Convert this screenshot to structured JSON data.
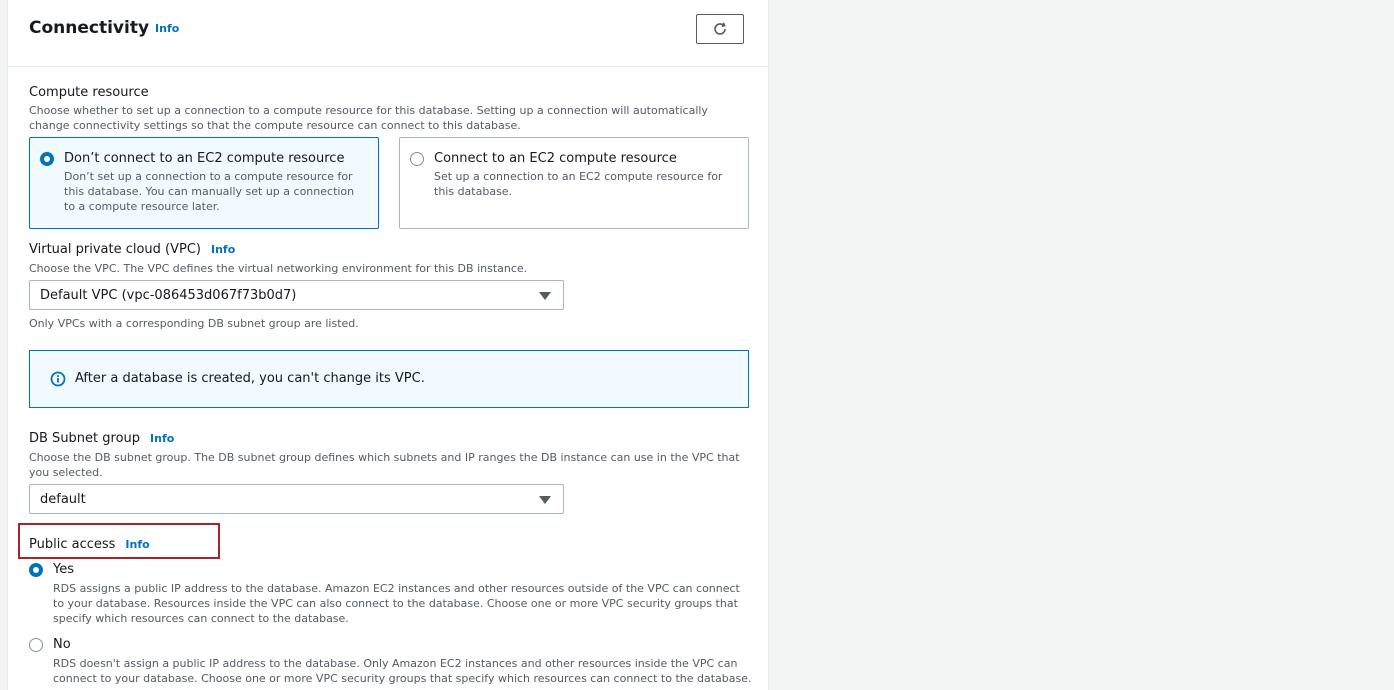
{
  "section": {
    "title": "Connectivity",
    "info": "Info"
  },
  "compute": {
    "label": "Compute resource",
    "description": "Choose whether to set up a connection to a compute resource for this database. Setting up a connection will automatically change connectivity settings so that the compute resource can connect to this database.",
    "options": [
      {
        "title": "Don’t connect to an EC2 compute resource",
        "description": "Don’t set up a connection to a compute resource for this database. You can manually set up a connection to a compute resource later.",
        "selected": true
      },
      {
        "title": "Connect to an EC2 compute resource",
        "description": "Set up a connection to an EC2 compute resource for this database.",
        "selected": false
      }
    ]
  },
  "vpc": {
    "label": "Virtual private cloud (VPC)",
    "info": "Info",
    "description": "Choose the VPC. The VPC defines the virtual networking environment for this DB instance.",
    "value": "Default VPC (vpc-086453d067f73b0d7)",
    "hint": "Only VPCs with a corresponding DB subnet group are listed."
  },
  "alert": {
    "text": "After a database is created, you can't change its VPC."
  },
  "subnet": {
    "label": "DB Subnet group",
    "info": "Info",
    "description": "Choose the DB subnet group. The DB subnet group defines which subnets and IP ranges the DB instance can use in the VPC that you selected.",
    "value": "default"
  },
  "public_access": {
    "label": "Public access",
    "info": "Info",
    "options": [
      {
        "title": "Yes",
        "description": "RDS assigns a public IP address to the database. Amazon EC2 instances and other resources outside of the VPC can connect to your database. Resources inside the VPC can also connect to the database. Choose one or more VPC security groups that specify which resources can connect to the database.",
        "selected": true
      },
      {
        "title": "No",
        "description": "RDS doesn't assign a public IP address to the database. Only Amazon EC2 instances and other resources inside the VPC can connect to your database. Choose one or more VPC security groups that specify which resources can connect to the database.",
        "selected": false
      }
    ]
  },
  "colors": {
    "accent": "#0073bb",
    "highlight": "#a4262c"
  }
}
